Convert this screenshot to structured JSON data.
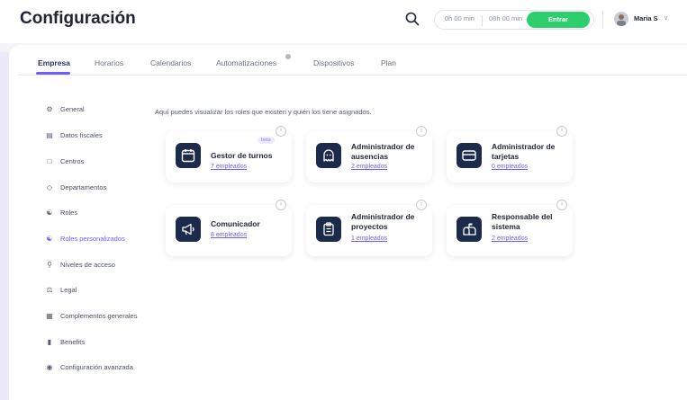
{
  "header": {
    "title": "Configuración",
    "clock_worked": "0h 00 min",
    "clock_target": "08h 00 min",
    "clock_in_button": "Entrar",
    "user_name": "Maria S"
  },
  "tabs": [
    "Empresa",
    "Horarios",
    "Calendarios",
    "Automatizaciones",
    "Dispositivos",
    "Plan"
  ],
  "sidebar": {
    "items": [
      {
        "label": "General",
        "icon": "gear-icon"
      },
      {
        "label": "Datos fiscales",
        "icon": "document-icon"
      },
      {
        "label": "Centros",
        "icon": "building-icon"
      },
      {
        "label": "Departamentos",
        "icon": "departments-icon"
      },
      {
        "label": "Roles",
        "icon": "roles-icon"
      },
      {
        "label": "Roles personalizados",
        "icon": "custom-roles-icon"
      },
      {
        "label": "Niveles de acceso",
        "icon": "key-icon"
      },
      {
        "label": "Legal",
        "icon": "legal-icon"
      },
      {
        "label": "Complementos generales",
        "icon": "complements-icon"
      },
      {
        "label": "Benefits",
        "icon": "benefits-icon"
      },
      {
        "label": "Configuración avanzada",
        "icon": "advanced-settings-icon"
      }
    ]
  },
  "main": {
    "description": "Aquí puedes visualizar los roles que existen y quién los tiene asignados.",
    "beta_label": "beta",
    "roles": [
      {
        "name": "Gestor de turnos",
        "employees": "7 empleados",
        "icon": "calendar-icon"
      },
      {
        "name": "Administrador de ausencias",
        "employees": "2 empleados",
        "icon": "ghost-icon"
      },
      {
        "name": "Administrador de tarjetas",
        "employees": "0 empleados",
        "icon": "credit-card-icon"
      },
      {
        "name": "Comunicador",
        "employees": "8 empleados",
        "icon": "megaphone-icon"
      },
      {
        "name": "Administrador de proyectos",
        "employees": "1 empleados",
        "icon": "clipboard-icon"
      },
      {
        "name": "Responsable del sistema",
        "employees": "2 empleados",
        "icon": "mailbox-icon"
      }
    ]
  },
  "colors": {
    "accent": "#6d5dfc",
    "green": "#2dcf6c",
    "icon_bg": "#1c2a4b"
  }
}
